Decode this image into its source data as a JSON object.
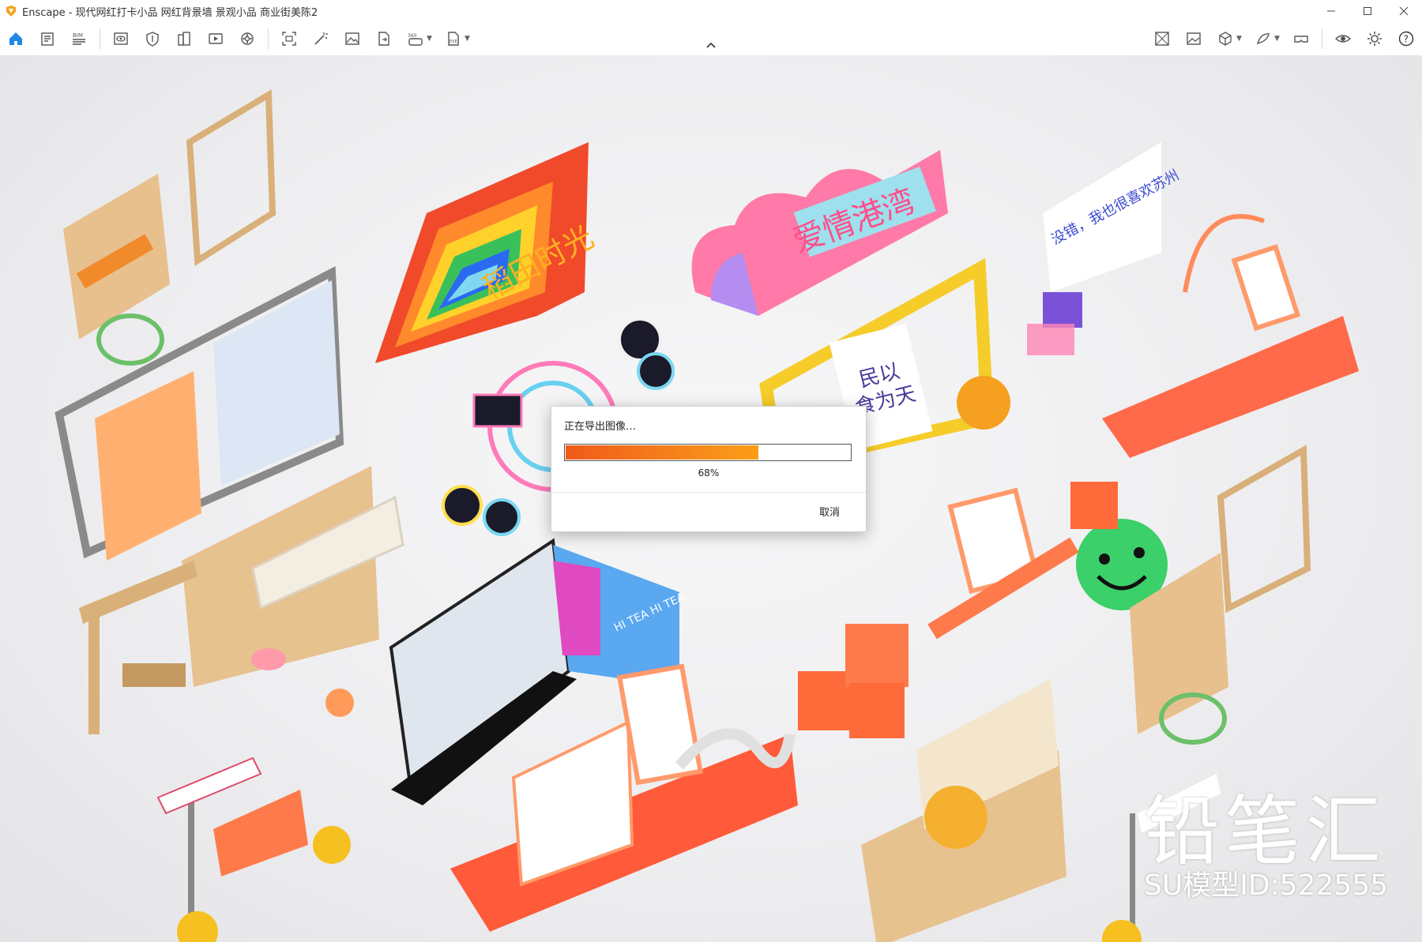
{
  "window": {
    "title": "Enscape - 现代网红打卡小品 网红背景墙 景观小品 商业街美陈2",
    "brand_color": "#f2a21e"
  },
  "toolbar": {
    "left_items": [
      "home-icon",
      "properties-icon",
      "bim-icon",
      "view-settings-icon",
      "shield-icon",
      "building-icon",
      "video-icon",
      "render-settings-icon",
      "screenshot-icon",
      "magic-wand-icon",
      "image-icon",
      "export-document-icon",
      "panorama-icon",
      "exe-export-icon"
    ],
    "right_items": [
      "asset-library-icon",
      "gallery-icon",
      "cube-icon",
      "material-icon",
      "vr-headset-icon",
      "visibility-icon",
      "settings-icon",
      "help-icon"
    ],
    "accent_color": "#1e88e5"
  },
  "export_dialog": {
    "title": "正在导出图像…",
    "progress": 68,
    "progress_text": "68%",
    "cancel_label": "取消"
  },
  "watermark": {
    "brand": "铅笔汇",
    "model_id": "SU模型ID:522555"
  }
}
